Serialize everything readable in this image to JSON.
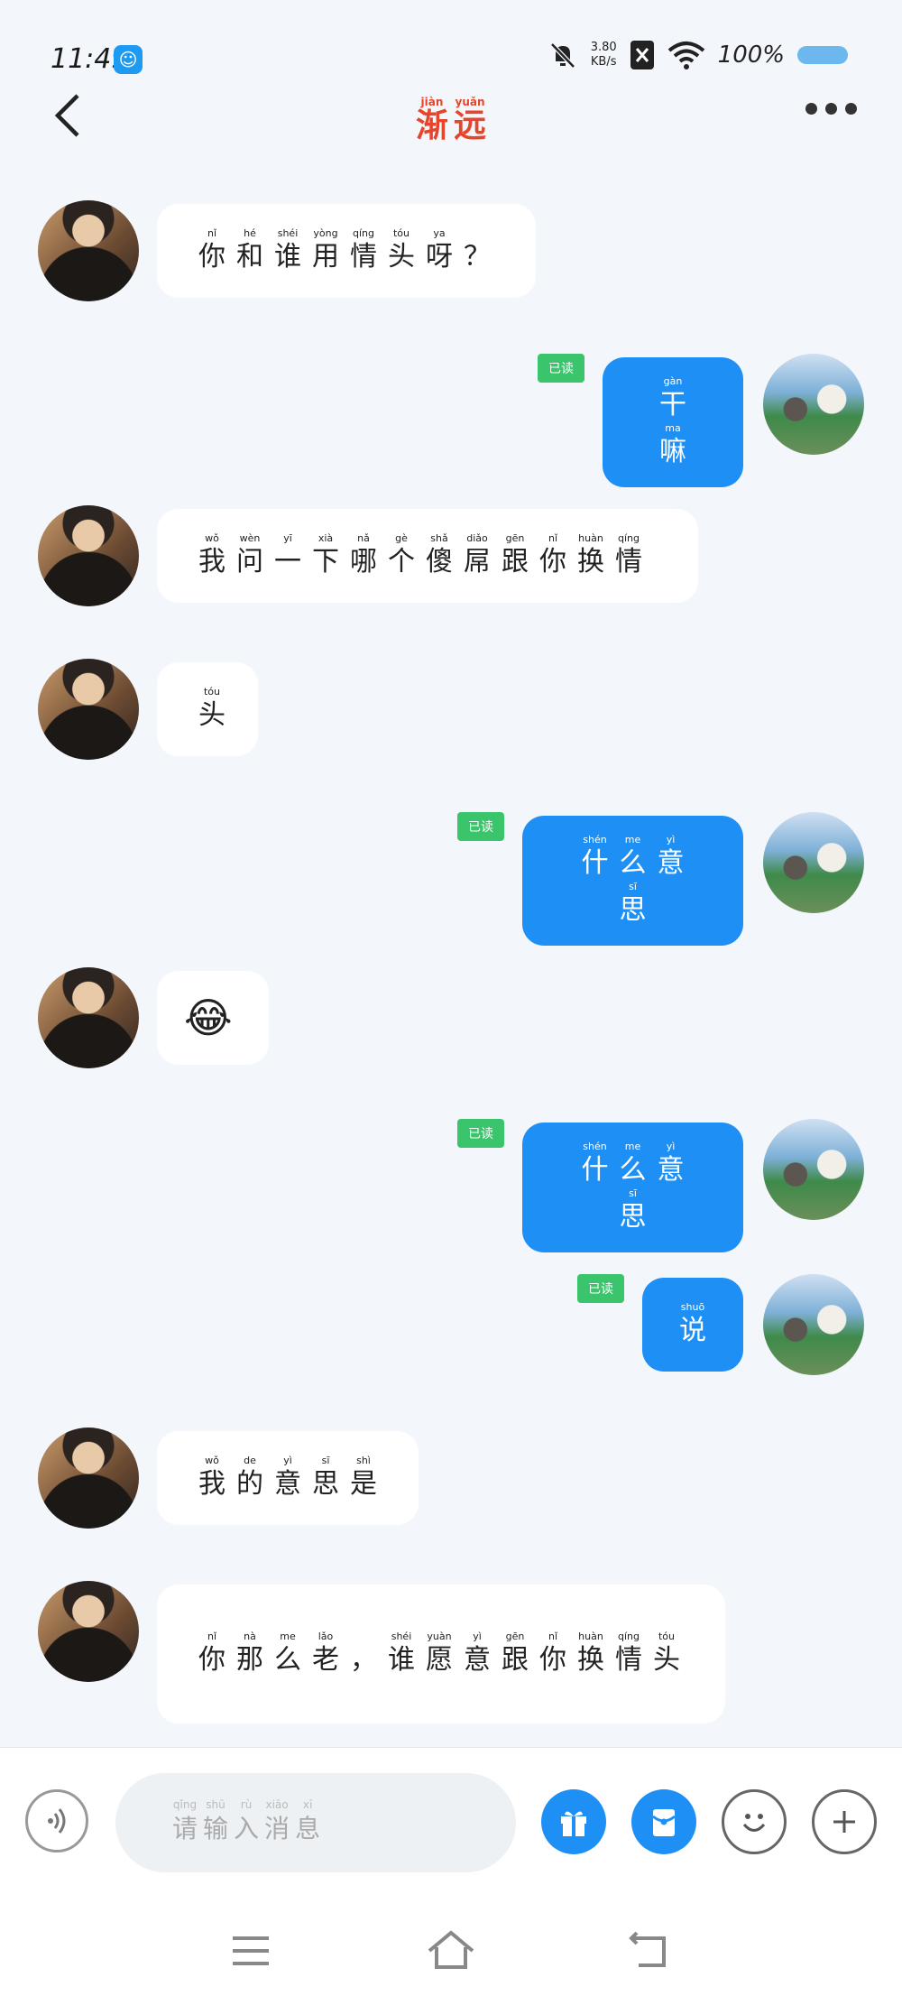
{
  "status_bar": {
    "time": "11:49",
    "net_speed_value": "3.80",
    "net_speed_unit": "KB/s",
    "battery_pct": "100%"
  },
  "header": {
    "title": [
      {
        "py": "jiàn",
        "hz": "渐"
      },
      {
        "py": "yuǎn",
        "hz": "远"
      }
    ]
  },
  "read_label": "已读",
  "input": {
    "placeholder": [
      {
        "py": "qǐng",
        "hz": "请"
      },
      {
        "py": "shū",
        "hz": "输"
      },
      {
        "py": "rù",
        "hz": "入"
      },
      {
        "py": "xiāo",
        "hz": "消"
      },
      {
        "py": "xī",
        "hz": "息"
      }
    ]
  },
  "messages": [
    {
      "side": "left",
      "words": [
        {
          "py": "nǐ",
          "hz": "你"
        },
        {
          "py": "hé",
          "hz": "和"
        },
        {
          "py": "shéi",
          "hz": "谁"
        },
        {
          "py": "yòng",
          "hz": "用"
        },
        {
          "py": "qíng",
          "hz": "情"
        },
        {
          "py": "tóu",
          "hz": "头"
        },
        {
          "py": "ya",
          "hz": "呀"
        },
        {
          "py": "",
          "hz": "？"
        }
      ]
    },
    {
      "side": "right",
      "read": true,
      "words": [
        {
          "py": "gàn",
          "hz": "干"
        },
        {
          "py": "ma",
          "hz": "嘛"
        }
      ]
    },
    {
      "side": "left",
      "words": [
        {
          "py": "wǒ",
          "hz": "我"
        },
        {
          "py": "wèn",
          "hz": "问"
        },
        {
          "py": "yī",
          "hz": "一"
        },
        {
          "py": "xià",
          "hz": "下"
        },
        {
          "py": "nǎ",
          "hz": "哪"
        },
        {
          "py": "gè",
          "hz": "个"
        },
        {
          "py": "shǎ",
          "hz": "傻"
        },
        {
          "py": "diǎo",
          "hz": "屌"
        },
        {
          "py": "gēn",
          "hz": "跟"
        },
        {
          "py": "nǐ",
          "hz": "你"
        },
        {
          "py": "huàn",
          "hz": "换"
        },
        {
          "py": "qíng",
          "hz": "情"
        }
      ]
    },
    {
      "side": "left",
      "words": [
        {
          "py": "tóu",
          "hz": "头"
        }
      ]
    },
    {
      "side": "right",
      "read": true,
      "words": [
        {
          "py": "shén",
          "hz": "什"
        },
        {
          "py": "me",
          "hz": "么"
        },
        {
          "py": "yì",
          "hz": "意"
        },
        {
          "py": "sī",
          "hz": "思"
        }
      ]
    },
    {
      "side": "left",
      "emoji": "😂"
    },
    {
      "side": "right",
      "read": true,
      "words": [
        {
          "py": "shén",
          "hz": "什"
        },
        {
          "py": "me",
          "hz": "么"
        },
        {
          "py": "yì",
          "hz": "意"
        },
        {
          "py": "sī",
          "hz": "思"
        }
      ]
    },
    {
      "side": "right",
      "read": true,
      "words": [
        {
          "py": "shuō",
          "hz": "说"
        }
      ]
    },
    {
      "side": "left",
      "words": [
        {
          "py": "wǒ",
          "hz": "我"
        },
        {
          "py": "de",
          "hz": "的"
        },
        {
          "py": "yì",
          "hz": "意"
        },
        {
          "py": "sī",
          "hz": "思"
        },
        {
          "py": "shì",
          "hz": "是"
        }
      ]
    },
    {
      "side": "left",
      "words": [
        {
          "py": "nǐ",
          "hz": "你"
        },
        {
          "py": "nà",
          "hz": "那"
        },
        {
          "py": "me",
          "hz": "么"
        },
        {
          "py": "lǎo",
          "hz": "老"
        },
        {
          "py": "",
          "hz": "，"
        },
        {
          "py": "shéi",
          "hz": "谁"
        },
        {
          "py": "yuàn",
          "hz": "愿"
        },
        {
          "py": "yì",
          "hz": "意"
        },
        {
          "py": "gēn",
          "hz": "跟"
        },
        {
          "py": "nǐ",
          "hz": "你"
        },
        {
          "py": "huàn",
          "hz": "换"
        },
        {
          "py": "qíng",
          "hz": "情"
        },
        {
          "py": "tóu",
          "hz": "头"
        }
      ]
    }
  ]
}
